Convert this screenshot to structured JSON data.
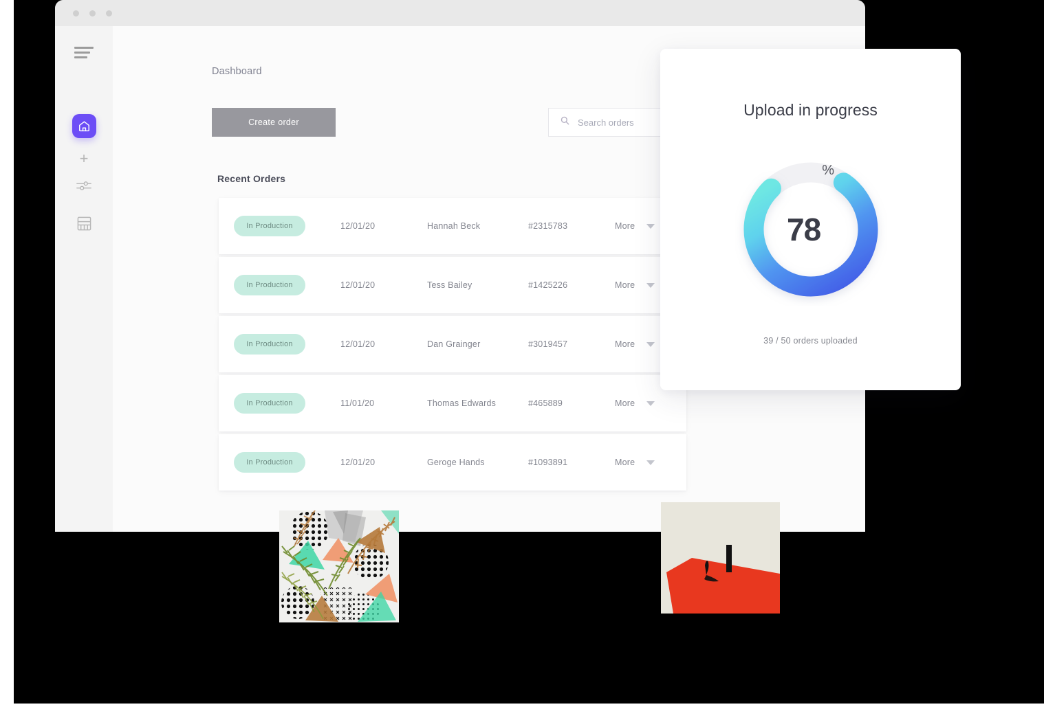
{
  "window": {
    "traffic_lights": [
      "close",
      "minimize",
      "maximize"
    ]
  },
  "sidebar": {
    "items": [
      {
        "icon": "hamburger-menu-icon",
        "label": "Menu",
        "active": false
      },
      {
        "icon": "home-icon",
        "label": "Home",
        "active": true
      },
      {
        "icon": "plus-icon",
        "label": "Add",
        "active": false
      },
      {
        "icon": "sliders-icon",
        "label": "Settings",
        "active": false
      },
      {
        "icon": "layout-grid-icon",
        "label": "Layout",
        "active": false
      }
    ],
    "active_color": "#6C4DF6"
  },
  "main": {
    "page_title": "Dashboard",
    "create_order_label": "Create order",
    "section_title": "Recent Orders",
    "search": {
      "placeholder": "Search orders",
      "value": "",
      "icon": "search-icon"
    },
    "orders": [
      {
        "status": "In Production",
        "date": "12/01/20",
        "customer": "Hannah Beck",
        "reference": "#2315783",
        "more": "More"
      },
      {
        "status": "In Production",
        "date": "12/01/20",
        "customer": "Tess Bailey",
        "reference": "#1425226",
        "more": "More"
      },
      {
        "status": "In Production",
        "date": "12/01/20",
        "customer": "Dan Grainger",
        "reference": "#3019457",
        "more": "More"
      },
      {
        "status": "In Production",
        "date": "11/01/20",
        "customer": "Thomas Edwards",
        "reference": "#465889",
        "more": "More"
      },
      {
        "status": "In Production",
        "date": "12/01/20",
        "customer": "Geroge Hands",
        "reference": "#1093891",
        "more": "More"
      }
    ],
    "status_badge_color": "#C6ECE0",
    "create_button_color": "#98989E"
  },
  "upload_card": {
    "title": "Upload in progress",
    "percent_value": "78",
    "percent_sign": "%",
    "subtitle": "39 / 50 orders uploaded",
    "progress": 78,
    "uploaded_count": 39,
    "total_count": 50,
    "gradient_start": "#62E0E3",
    "gradient_end": "#4361E8",
    "track_color": "#F2F2F4"
  },
  "thumbnails": [
    {
      "name": "tropical-geometric-collage",
      "alt": "Tropical leaves and geometric triangles collage pattern"
    },
    {
      "name": "minimal-red-plane-figure",
      "alt": "Minimalist illustration of a figure on a red plane with black pillar"
    }
  ]
}
